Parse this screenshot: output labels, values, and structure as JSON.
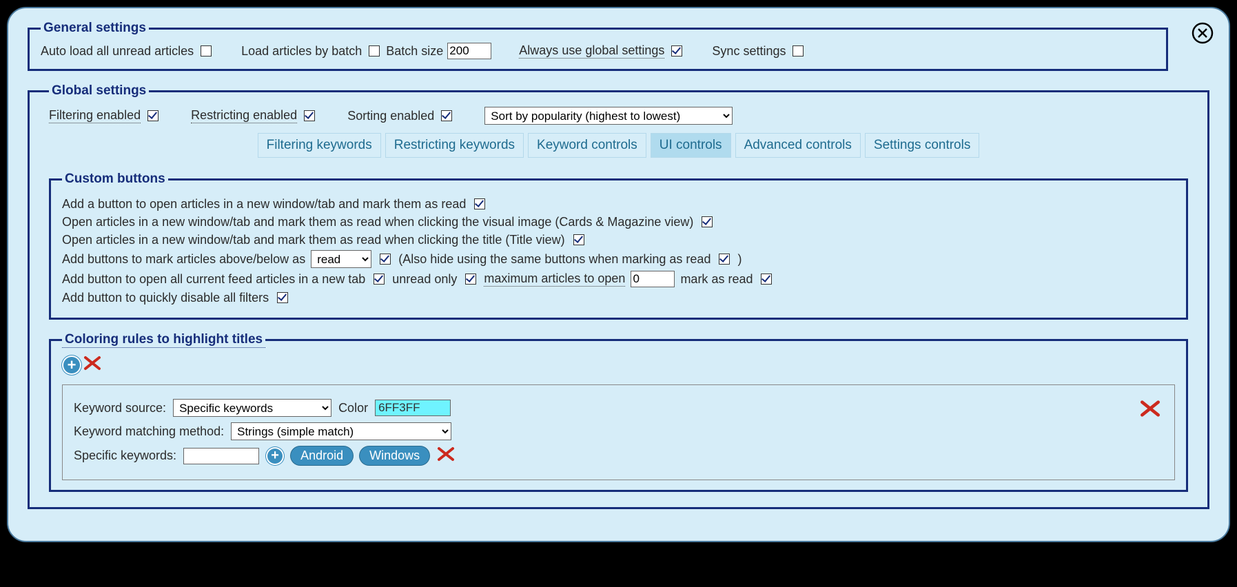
{
  "general": {
    "legend": "General settings",
    "auto_load": "Auto load all unread articles",
    "load_batch": "Load articles by batch",
    "batch_size_label": "Batch size",
    "batch_size_value": 200,
    "always_global": "Always use global settings",
    "sync": "Sync settings"
  },
  "global": {
    "legend": "Global settings",
    "filtering": "Filtering enabled",
    "restricting": "Restricting enabled",
    "sorting": "Sorting enabled",
    "sort_value": "Sort by popularity (highest to lowest)"
  },
  "tabs": {
    "t0": "Filtering keywords",
    "t1": "Restricting keywords",
    "t2": "Keyword controls",
    "t3": "UI controls",
    "t4": "Advanced controls",
    "t5": "Settings controls"
  },
  "custom": {
    "legend": "Custom buttons",
    "r0": "Add a button to open articles in a new window/tab and mark them as read",
    "r1": "Open articles in a new window/tab and mark them as read when clicking the visual image (Cards & Magazine view)",
    "r2": "Open articles in a new window/tab and mark them as read when clicking the title (Title view)",
    "r3a": "Add buttons to mark articles above/below as",
    "r3_select": "read",
    "r3b": "(Also hide using the same buttons when marking as read",
    "r3c": ")",
    "r4a": "Add button to open all current feed articles in a new tab",
    "r4b": "unread only",
    "r4c": "maximum articles to open",
    "r4_value": 0,
    "r4d": "mark as read",
    "r5": "Add button to quickly disable all filters"
  },
  "coloring": {
    "legend": "Coloring rules to highlight titles",
    "kw_source_label": "Keyword source:",
    "kw_source_value": "Specific keywords",
    "color_label": "Color",
    "color_value": "6FF3FF",
    "kw_match_label": "Keyword matching method:",
    "kw_match_value": "Strings (simple match)",
    "specific_label": "Specific keywords:",
    "pill0": "Android",
    "pill1": "Windows"
  }
}
